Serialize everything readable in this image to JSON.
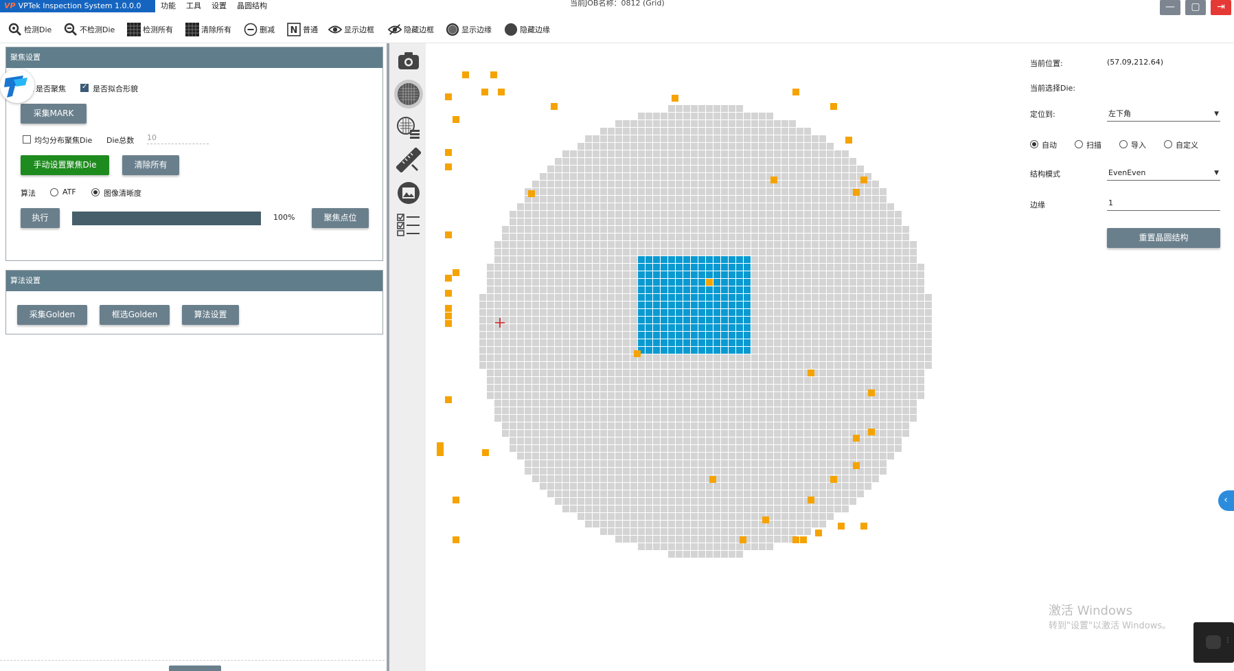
{
  "window": {
    "app_title": "VPTek Inspection System 1.0.0.0",
    "app_logo": "VP",
    "job_title": "当前JOB名称：0812 (Grid)",
    "menu": [
      "功能",
      "工具",
      "设置",
      "晶圆结构"
    ],
    "controls": {
      "minimize_icon": "minimize-icon",
      "maximize_icon": "maximize-icon",
      "exit_icon": "exit-icon"
    }
  },
  "toolbar": {
    "items": [
      {
        "label": "检测Die",
        "icon": "magnifier-icon"
      },
      {
        "label": "不检测Die",
        "icon": "magnifier-minus-icon"
      },
      {
        "label": "检测所有",
        "icon": "grid-dark-icon"
      },
      {
        "label": "清除所有",
        "icon": "grid-dark-icon"
      },
      {
        "label": "删减",
        "icon": "minus-circle-icon"
      },
      {
        "label": "普通",
        "icon": "n-box-icon"
      },
      {
        "label": "显示边框",
        "icon": "eye-icon"
      },
      {
        "label": "隐藏边框",
        "icon": "eye-off-icon"
      },
      {
        "label": "显示边缘",
        "icon": "circle-ring-icon"
      },
      {
        "label": "隐藏边缘",
        "icon": "circle-filled-icon"
      }
    ]
  },
  "focus_group": {
    "header": "聚焦设置",
    "chk_focus_label": "是否聚焦",
    "chk_focus_checked": false,
    "chk_fit_label": "是否拟合形貌",
    "chk_fit_checked": true,
    "btn_collect_mark": "采集MARK",
    "chk_uniform_label": "均匀分布聚焦Die",
    "chk_uniform_checked": false,
    "die_total_label": "Die总数",
    "die_total_value": "10",
    "btn_manual_focus": "手动设置聚焦Die",
    "btn_clear_all": "清除所有",
    "algo_label": "算法",
    "algo_options": [
      "ATF",
      "图像清晰度"
    ],
    "algo_selected": 1,
    "btn_execute": "执行",
    "progress_value": 1.0,
    "progress_text": "100%",
    "btn_focus_point": "聚焦点位"
  },
  "algo_group": {
    "header": "算法设置",
    "btn_collect_golden": "采集Golden",
    "btn_select_golden": "框选Golden",
    "btn_algo_settings": "算法设置"
  },
  "side_tools": [
    "camera-icon",
    "wafer-grid-icon",
    "wafer-list-icon",
    "ruler-icon",
    "image-frame-icon",
    "checklist-icon"
  ],
  "info": {
    "pos_label": "当前位置:",
    "pos_value": "(57.09,212.64)",
    "selected_die_label": "当前选择Die:",
    "locate_label": "定位到:",
    "locate_value": "左下角",
    "mode_options": [
      "自动",
      "扫描",
      "导入",
      "自定义"
    ],
    "mode_selected": 0,
    "struct_label": "结构模式",
    "struct_value": "EvenEven",
    "edge_label": "边缘",
    "edge_value": "1",
    "btn_reset": "重置晶圆结构"
  },
  "watermark": {
    "line1": "激活 Windows",
    "line2": "转到\"设置\"以激活 Windows。"
  },
  "colors": {
    "accent_blue": "#1565c0",
    "die_gray": "#d4d4d4",
    "die_selected": "#0a9ad1",
    "marker_orange": "#f5a300",
    "button_slate": "#6a7f8c",
    "button_green": "#1e8b1e",
    "crosshair": "#d32f2f"
  },
  "wafer": {
    "grid_cols": 60,
    "grid_rows": 62,
    "selected_region": {
      "col_start": 21,
      "col_end": 35,
      "row_start": 21,
      "row_end": 33
    },
    "selected_region_marker": {
      "col": 30,
      "row": 24
    }
  }
}
